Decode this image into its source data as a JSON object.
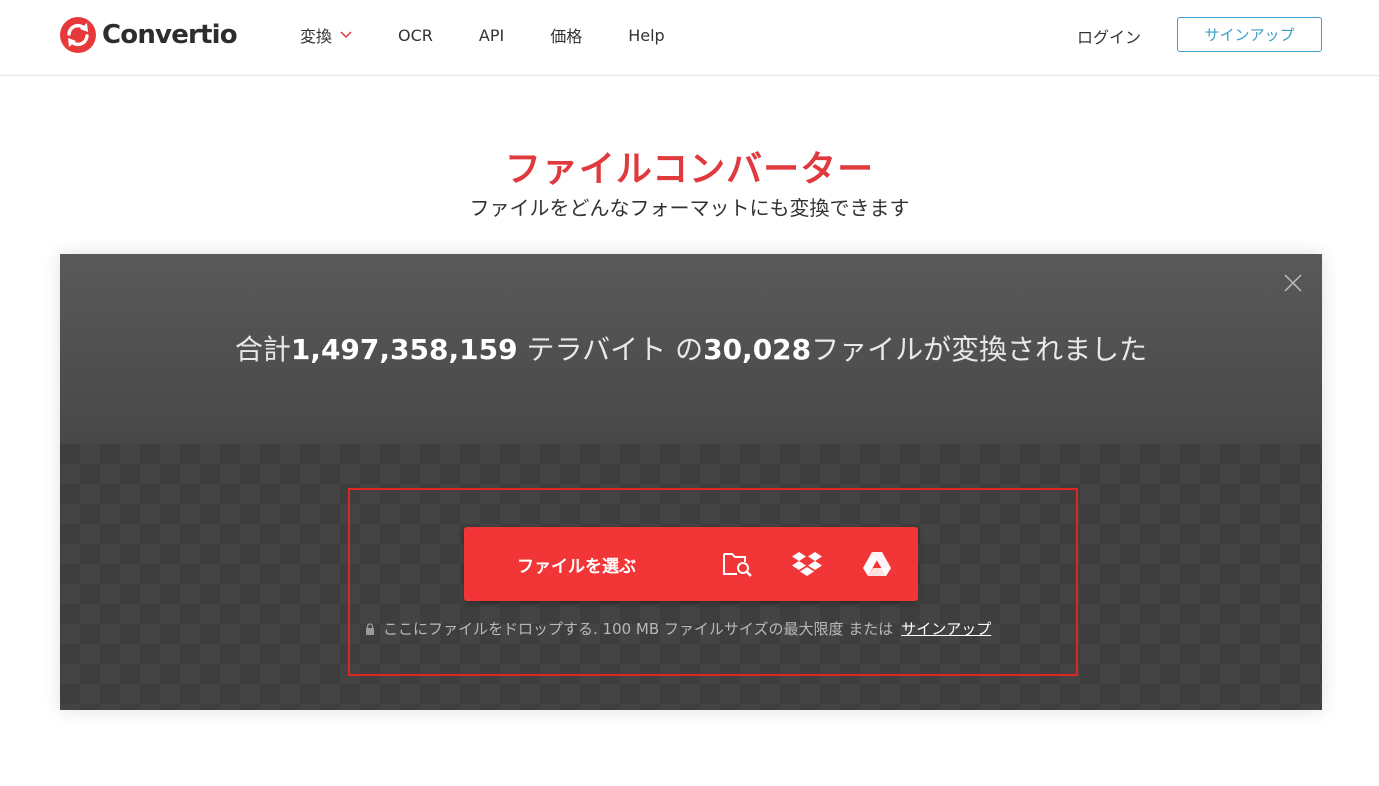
{
  "header": {
    "logo_text": "Convertio",
    "nav": [
      "変換",
      "OCR",
      "API",
      "価格",
      "Help"
    ],
    "login": "ログイン",
    "signup": "サインアップ"
  },
  "hero": {
    "title": "ファイルコンバーター",
    "subtitle": "ファイルをどんなフォーマットにも変換できます"
  },
  "stats": {
    "prefix": "合計",
    "terabytes": "1,497,358,159",
    "mid": " テラバイト の",
    "files": "30,028",
    "suffix": "ファイルが変換されました"
  },
  "uploader": {
    "choose_label": "ファイルを選ぶ",
    "sources": [
      "folder-search-icon",
      "dropbox-icon",
      "google-drive-icon"
    ],
    "drop_note": "ここにファイルをドロップする. 100 MB ファイルサイズの最大限度 または",
    "signup_link": "サインアップ"
  },
  "colors": {
    "brand_red": "#f23637",
    "title_red": "#e03a3e",
    "signup_blue": "#3ba1c8",
    "highlight_border": "#e0271f"
  }
}
